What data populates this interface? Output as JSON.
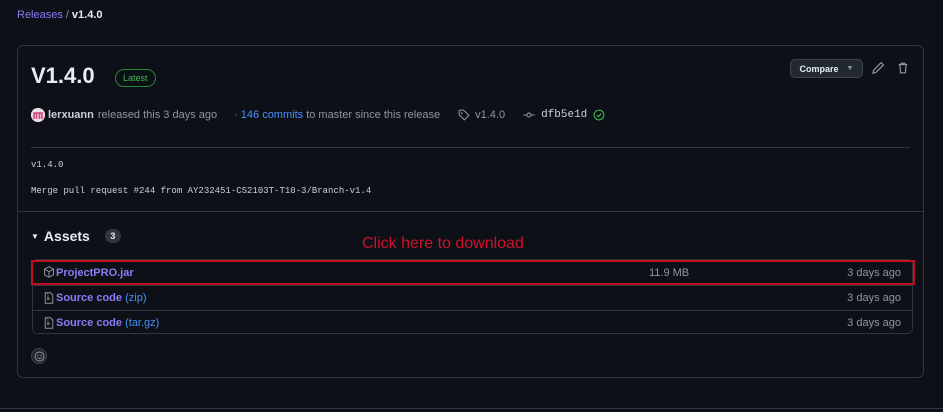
{
  "breadcrumb": {
    "parent": "Releases",
    "separator": "/",
    "current": "v1.4.0"
  },
  "release": {
    "title": "V1.4.0",
    "badge": "Latest",
    "compare_label": "Compare",
    "author": "lerxuann",
    "released_text": "released this 3 days ago",
    "commits_link": "146 commits",
    "commits_suffix": "to master since this release",
    "tag": "v1.4.0",
    "sha": "dfb5e1d",
    "body_line1": "v1.4.0",
    "body_line2": "Merge pull request #244 from AY232451-CS2103T-T10-3/Branch-v1.4"
  },
  "assets": {
    "heading": "Assets",
    "count": "3",
    "items": [
      {
        "name": "ProjectPRO.jar",
        "ext": "",
        "size": "11.9 MB",
        "date": "3 days ago",
        "icon": "package-icon"
      },
      {
        "name": "Source code",
        "ext": "(zip)",
        "size": "",
        "date": "3 days ago",
        "icon": "file-zip-icon"
      },
      {
        "name": "Source code",
        "ext": "(tar.gz)",
        "size": "",
        "date": "3 days ago",
        "icon": "file-zip-icon"
      }
    ]
  },
  "annotation": {
    "text": "Click here to download",
    "color": "#d0102a"
  },
  "colors": {
    "background": "#0d1117",
    "link": "#4493f8",
    "accent_purple": "#8b7cf6",
    "latest_green": "#3fb950"
  }
}
